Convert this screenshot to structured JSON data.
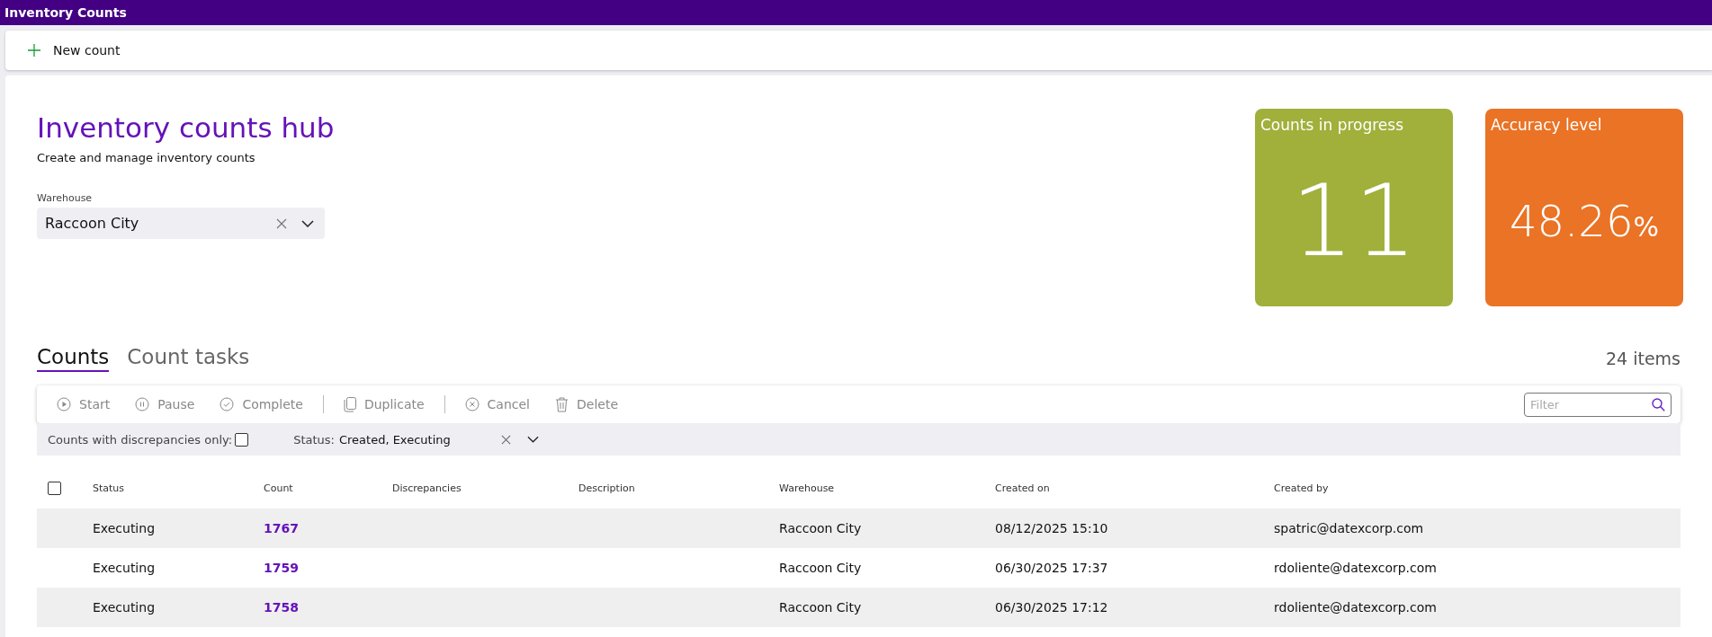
{
  "window": {
    "title": "Inventory Counts"
  },
  "command_bar": {
    "new_button": "New count"
  },
  "header": {
    "title": "Inventory counts hub",
    "subtitle": "Create and manage inventory counts",
    "warehouse": {
      "label": "Warehouse",
      "value": "Raccoon City"
    }
  },
  "tiles": [
    {
      "title": "Counts in progress",
      "value": "11",
      "color": "#a0b03b"
    },
    {
      "title": "Accuracy level",
      "value": "48.26",
      "unit": "%",
      "color": "#ea7325"
    }
  ],
  "tabs": [
    {
      "label": "Counts",
      "selected": true
    },
    {
      "label": "Count tasks",
      "selected": false
    }
  ],
  "item_count": "24 items",
  "toolbar": [
    {
      "kind": "play",
      "label": "Start"
    },
    {
      "kind": "pause",
      "label": "Pause"
    },
    {
      "kind": "check",
      "label": "Complete"
    },
    {
      "kind": "divider"
    },
    {
      "kind": "copy",
      "label": "Duplicate"
    },
    {
      "kind": "divider"
    },
    {
      "kind": "cancel",
      "label": "Cancel"
    },
    {
      "kind": "trash",
      "label": "Delete"
    }
  ],
  "filter": {
    "placeholder": "Filter"
  },
  "discrepancies_filter": {
    "label": "Counts with discrepancies only:",
    "checked": false
  },
  "status_filter": {
    "label": "Status:",
    "value": "Created, Executing"
  },
  "table": {
    "select_all": false,
    "columns": [
      "Status",
      "Count",
      "Discrepancies",
      "Description",
      "Warehouse",
      "Created on",
      "Created by"
    ],
    "rows": [
      {
        "status": "Executing",
        "count": "1767",
        "warehouse": "Raccoon City",
        "created_on": "08/12/2025 15:10",
        "created_by": "spatric@datexcorp.com"
      },
      {
        "status": "Executing",
        "count": "1759",
        "warehouse": "Raccoon City",
        "created_on": "06/30/2025 17:37",
        "created_by": "rdoliente@datexcorp.com"
      },
      {
        "status": "Executing",
        "count": "1758",
        "warehouse": "Raccoon City",
        "created_on": "06/30/2025 17:12",
        "created_by": "rdoliente@datexcorp.com"
      }
    ]
  }
}
